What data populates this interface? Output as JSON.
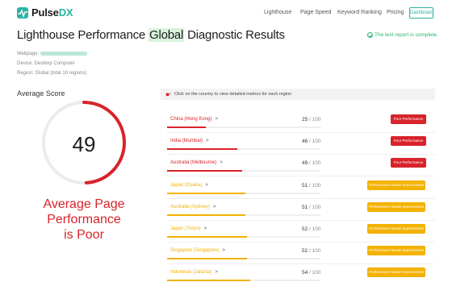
{
  "header": {
    "logo_main": "Pulse",
    "logo_accent": "DX",
    "nav": [
      "Lighthouse",
      "Page Speed",
      "Keyword Ranking",
      "Pricing"
    ],
    "dashboard": "Dashboard"
  },
  "title": {
    "pre": "Lighthouse Performance ",
    "highlight": "Global",
    "post": " Diagnostic Results"
  },
  "complete_text": "The test report is complete.",
  "meta": {
    "webpage_label": "Webpage:",
    "device": "Device: Desktop Computer",
    "region": "Region: Global (total 10 regions)"
  },
  "average": {
    "label": "Average Score",
    "score": "49",
    "max": 100,
    "verdict_line1": "Average Page Performance",
    "verdict_line2": "is Poor"
  },
  "info_text": "Click on the country to view detailed metrics for each region",
  "colors": {
    "poor": "#d8232a",
    "needs": "#f3b200",
    "accent": "#2bb3a3"
  },
  "regions": [
    {
      "name": "China (Hong Kong)",
      "score": "25",
      "of": " / 100",
      "status": "Poor Performance",
      "level": "poor"
    },
    {
      "name": "India (Mumbai)",
      "score": "46",
      "of": " / 100",
      "status": "Poor Performance",
      "level": "poor"
    },
    {
      "name": "Australia (Melbourne)",
      "score": "49",
      "of": " / 100",
      "status": "Poor Performance",
      "level": "poor"
    },
    {
      "name": "Japan (Osaka)",
      "score": "51",
      "of": " / 100",
      "status": "Performance Needs Improvement",
      "level": "needs"
    },
    {
      "name": "Australia (Sydney)",
      "score": "51",
      "of": " / 100",
      "status": "Performance Needs Improvement",
      "level": "needs"
    },
    {
      "name": "Japan (Tokyo)",
      "score": "52",
      "of": " / 100",
      "status": "Performance Needs Improvement",
      "level": "needs"
    },
    {
      "name": "Singapore (Singapore)",
      "score": "52",
      "of": " / 100",
      "status": "Performance Needs Improvement",
      "level": "needs"
    },
    {
      "name": "Indonesia (Jakarta)",
      "score": "54",
      "of": " / 100",
      "status": "Performance Needs Improvement",
      "level": "needs"
    }
  ]
}
